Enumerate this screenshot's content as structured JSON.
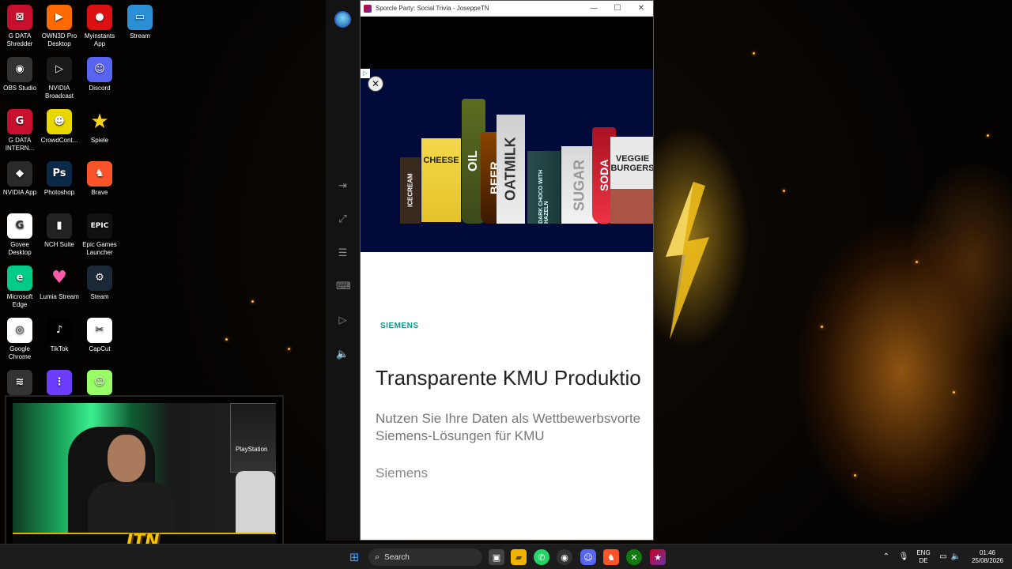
{
  "desktop": {
    "icons": [
      {
        "label": "G DATA Shredder",
        "color": "#c8102e",
        "glyph": "⊠"
      },
      {
        "label": "OWN3D Pro Desktop",
        "color": "#ff6a00",
        "glyph": "▶"
      },
      {
        "label": "Myinstants App",
        "color": "#d11",
        "glyph": "●"
      },
      {
        "label": "Stream",
        "color": "#2b8fd6",
        "glyph": "▭"
      },
      {
        "label": "OBS Studio",
        "color": "#333",
        "glyph": "◉"
      },
      {
        "label": "NVIDIA Broadcast",
        "color": "#1a1a1a",
        "glyph": "▷"
      },
      {
        "label": "Discord",
        "color": "#5865f2",
        "glyph": "☺"
      },
      {
        "label": "G DATA INTERN...",
        "color": "#c8102e",
        "glyph": "G"
      },
      {
        "label": "CrowdCont...",
        "color": "#e8d800",
        "glyph": "☻"
      },
      {
        "label": "Spiele",
        "color": "transparent",
        "glyph": "★"
      },
      {
        "label": "NVIDIA App",
        "color": "#2a2a2a",
        "glyph": "◆"
      },
      {
        "label": "Photoshop",
        "color": "#0b2a4a",
        "glyph": "Ps"
      },
      {
        "label": "Brave",
        "color": "#fb542b",
        "glyph": "♞"
      },
      {
        "label": "Govee Desktop",
        "color": "#fff",
        "glyph": "G"
      },
      {
        "label": "NCH Suite",
        "color": "#222",
        "glyph": "▮"
      },
      {
        "label": "Epic Games Launcher",
        "color": "#111",
        "glyph": "EPIC"
      },
      {
        "label": "Microsoft Edge",
        "color": "#0c8",
        "glyph": "e"
      },
      {
        "label": "Lumia Stream",
        "color": "transparent",
        "glyph": "♥"
      },
      {
        "label": "Steam",
        "color": "#1b2838",
        "glyph": "⚙"
      },
      {
        "label": "Google Chrome",
        "color": "#fff",
        "glyph": "◎"
      },
      {
        "label": "TikTok",
        "color": "#000",
        "glyph": "♪"
      },
      {
        "label": "CapCut",
        "color": "#fff",
        "glyph": "✂"
      },
      {
        "label": "",
        "color": "#333",
        "glyph": "≋"
      },
      {
        "label": "",
        "color": "#6c3cff",
        "glyph": "⋮"
      },
      {
        "label": "",
        "color": "#9f6",
        "glyph": "☺"
      }
    ]
  },
  "window": {
    "title": "Sporcle Party: Social Trivia - JoseppeTN",
    "minimize": "—",
    "maximize": "☐",
    "close": "✕"
  },
  "ad": {
    "choices": "▷",
    "close": "✕",
    "products": [
      "ICECREAM",
      "CHEESE",
      "OIL",
      "BEER",
      "OATMILK",
      "DARK CHOCO WITH HAZELN",
      "SUGAR",
      "SODA",
      "VEGGIE BURGERS"
    ],
    "brand": "SIEMENS",
    "headline": "Transparente KMU Produktio",
    "subline": "Nutzen Sie Ihre Daten als Wettbewerbsvorte\nSiemens-Lösungen für KMU",
    "advertiser": "Siemens"
  },
  "rail": {
    "icons": [
      "exit-icon",
      "expand-icon",
      "sliders-icon",
      "keyboard-icon",
      "label-icon",
      "volume-icon"
    ],
    "glyphs": [
      "⇥",
      "⤢",
      "☰",
      "⌨",
      "▷",
      "🔈"
    ]
  },
  "overlay": {
    "logo": "JTN",
    "brand_on_box": "PlayStation"
  },
  "taskbar": {
    "search_label": "Search",
    "lang_top": "ENG",
    "lang_bottom": "DE",
    "time": "01:46",
    "date": "25/08/2026"
  }
}
